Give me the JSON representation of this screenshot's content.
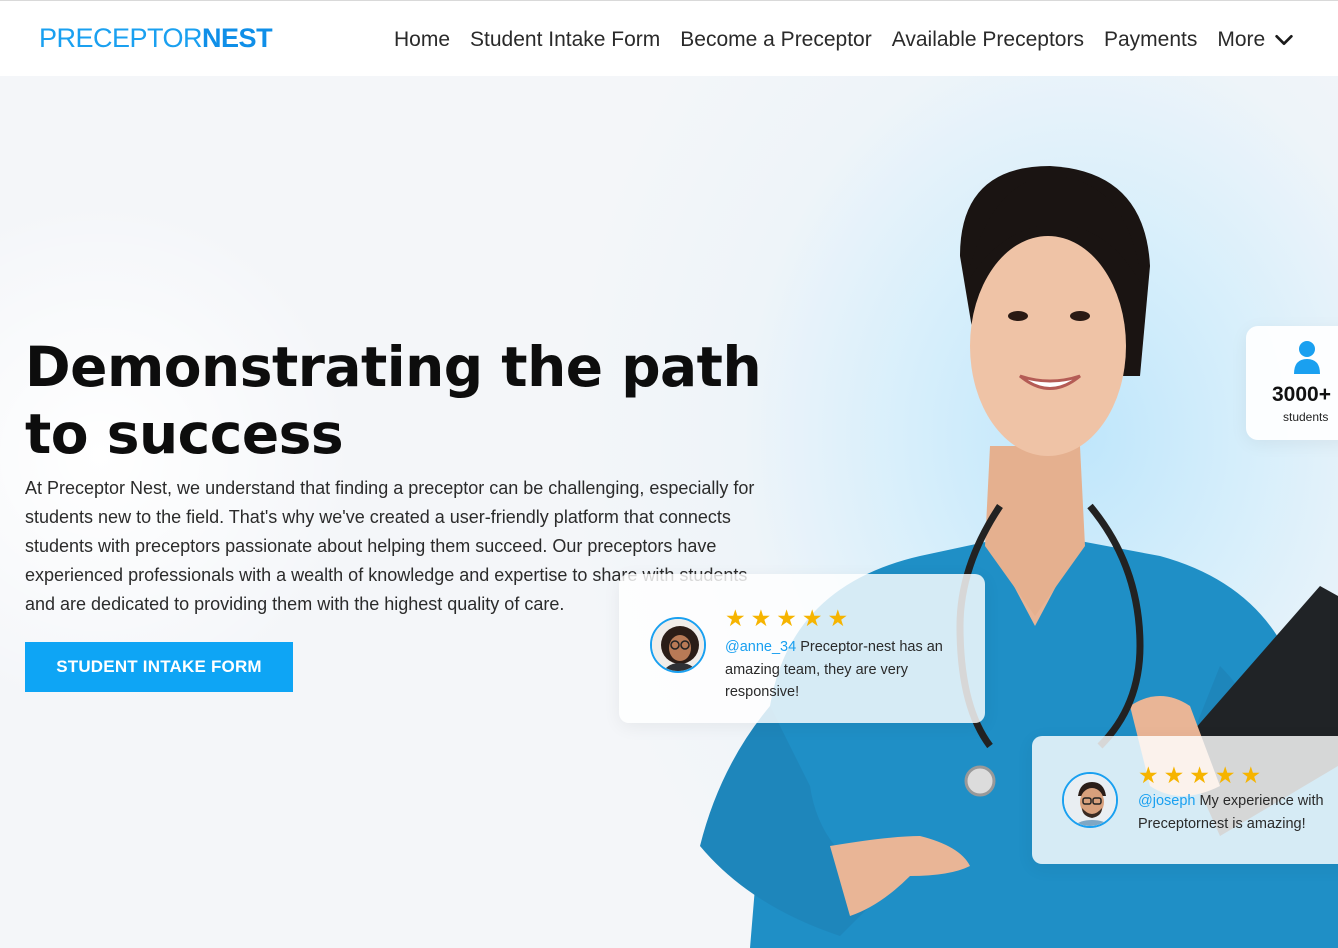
{
  "header": {
    "logo": {
      "part1": "PRECEPTOR",
      "part2": "NEST"
    },
    "nav": [
      {
        "label": "Home"
      },
      {
        "label": "Student Intake Form"
      },
      {
        "label": "Become a Preceptor"
      },
      {
        "label": "Available Preceptors"
      },
      {
        "label": "Payments"
      }
    ],
    "more_label": "More",
    "more_icon": "chevron-down-icon"
  },
  "hero": {
    "headline": "Demonstrating the path to success",
    "intro": "At Preceptor Nest, we understand that finding a preceptor can be challenging, especially for students new to the field. That's why we've created a user-friendly platform that connects students with preceptors passionate about helping them succeed. Our preceptors have experienced professionals with a wealth of knowledge and expertise to share with students and are dedicated to providing them with the highest quality of care.",
    "cta_label": "STUDENT INTAKE FORM"
  },
  "stats": {
    "icon": "user-icon",
    "value": "3000+",
    "label": "students"
  },
  "reviews": [
    {
      "rating": 5,
      "handle": "@anne_34",
      "text": " Preceptor-nest has an amazing team, they are very responsive!"
    },
    {
      "rating": 5,
      "handle": "@joseph",
      "text": " My experience with Preceptornest is amazing!"
    }
  ],
  "colors": {
    "brand": "#0ea5f5",
    "star": "#f6b400",
    "scrubs": "#1f8fc6"
  }
}
